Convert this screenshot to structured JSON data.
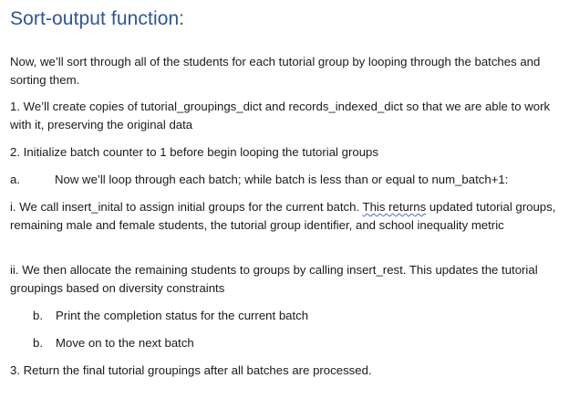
{
  "heading": "Sort-output function:",
  "paragraphs": {
    "intro": "Now, we’ll sort through all of the students for each tutorial group by looping through the batches and sorting them.",
    "step1": "1. We’ll create copies of tutorial_groupings_dict and records_indexed_dict so that we are able to work with it, preserving the original data",
    "step2": "2. Initialize batch counter to 1 before begin looping the tutorial groups",
    "step_a_marker": "a.",
    "step_a_text": "Now we’ll loop through each batch; while batch is less than or equal to num_batch+1:",
    "step_i_before": "i. We call insert_inital to assign initial groups for the current batch. ",
    "step_i_flagged": "This returns",
    "step_i_after": " updated tutorial groups, remaining male and female students, the tutorial group identifier, and school inequality metric",
    "step_ii": "ii. We then allocate the remaining students to groups by calling insert_rest. This updates the tutorial groupings based on diversity constraints",
    "step_b1_marker": "b.",
    "step_b1_text": "Print the completion status for the current batch",
    "step_b2_marker": "b.",
    "step_b2_text": "Move on to the next batch",
    "step3": "3. Return the final tutorial groupings after all batches are processed."
  }
}
